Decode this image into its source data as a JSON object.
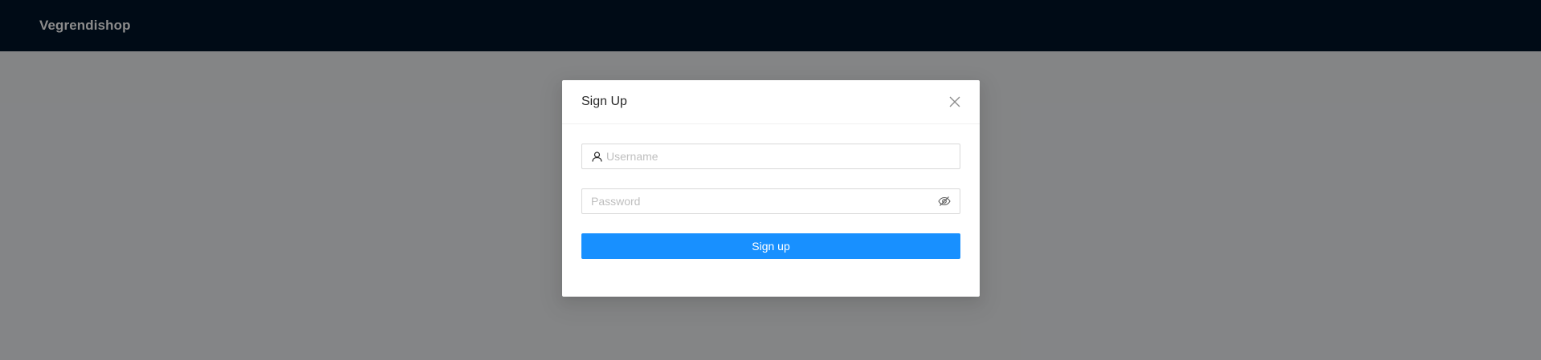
{
  "header": {
    "brand": "Vegrendishop",
    "background": "#001529"
  },
  "modal": {
    "title": "Sign Up",
    "close_icon": "close-icon",
    "username": {
      "placeholder": "Username",
      "value": "",
      "icon": "user-icon"
    },
    "password": {
      "placeholder": "Password",
      "value": "",
      "icon": "eye-invisible-icon"
    },
    "submit_label": "Sign up",
    "accent": "#1890ff"
  }
}
